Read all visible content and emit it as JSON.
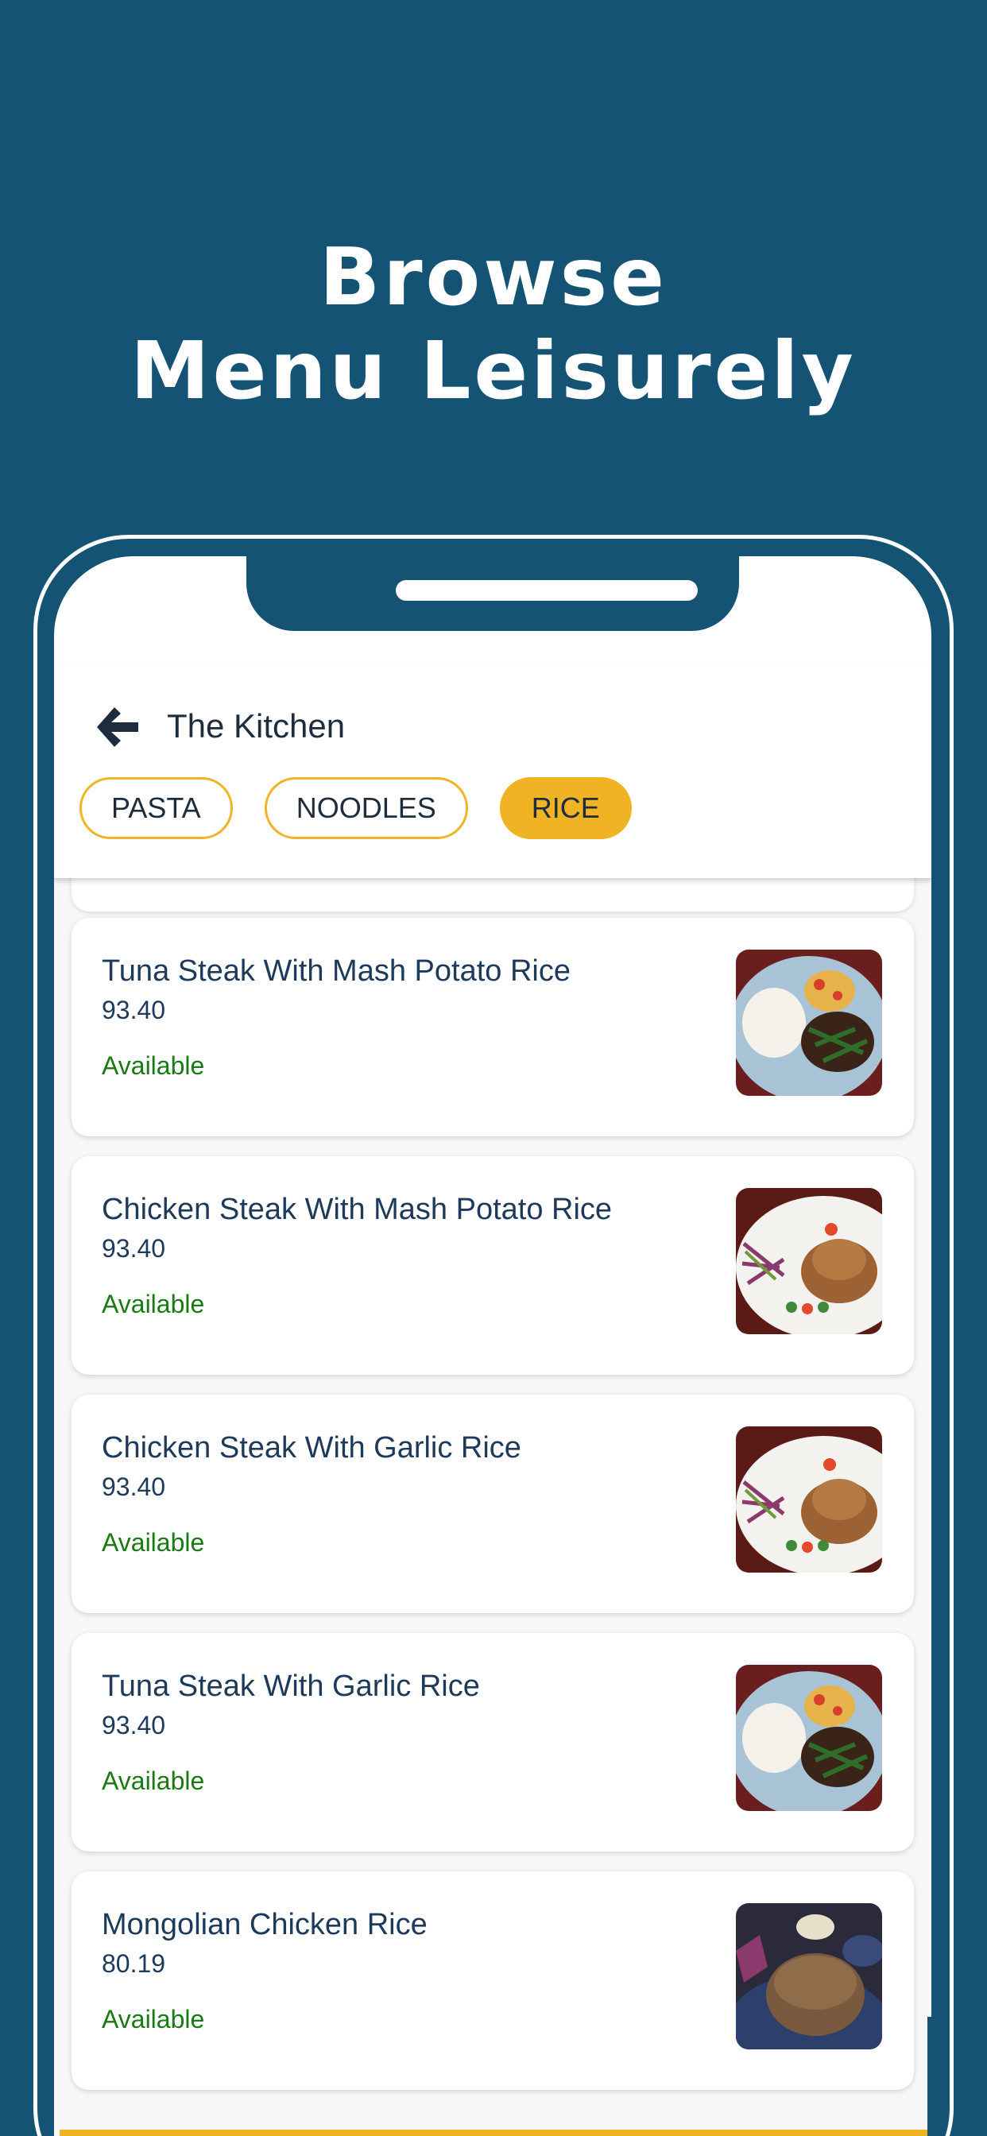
{
  "headline": {
    "line1": "Browse",
    "line2": "Menu Leisurely"
  },
  "app": {
    "title": "The Kitchen",
    "back_icon": "arrow-left-icon",
    "tabs": [
      {
        "label": "PASTA",
        "active": false
      },
      {
        "label": "NOODLES",
        "active": false
      },
      {
        "label": "RICE",
        "active": true
      }
    ]
  },
  "menu_items": [
    {
      "name": "Tuna Steak With Mash Potato Rice",
      "price": "93.40",
      "status": "Available",
      "image": "tuna-rice-dish"
    },
    {
      "name": "Chicken Steak With Mash Potato Rice",
      "price": "93.40",
      "status": "Available",
      "image": "chicken-steak-dish"
    },
    {
      "name": "Chicken Steak With Garlic Rice",
      "price": "93.40",
      "status": "Available",
      "image": "chicken-steak-dish"
    },
    {
      "name": "Tuna Steak With Garlic Rice",
      "price": "93.40",
      "status": "Available",
      "image": "tuna-rice-dish"
    },
    {
      "name": "Mongolian Chicken Rice",
      "price": "80.19",
      "status": "Available",
      "image": "mongolian-rice-dish"
    }
  ],
  "colors": {
    "background": "#145374",
    "accent": "#f0b323",
    "available": "#1a7a12",
    "text": "#1e3a5a"
  }
}
